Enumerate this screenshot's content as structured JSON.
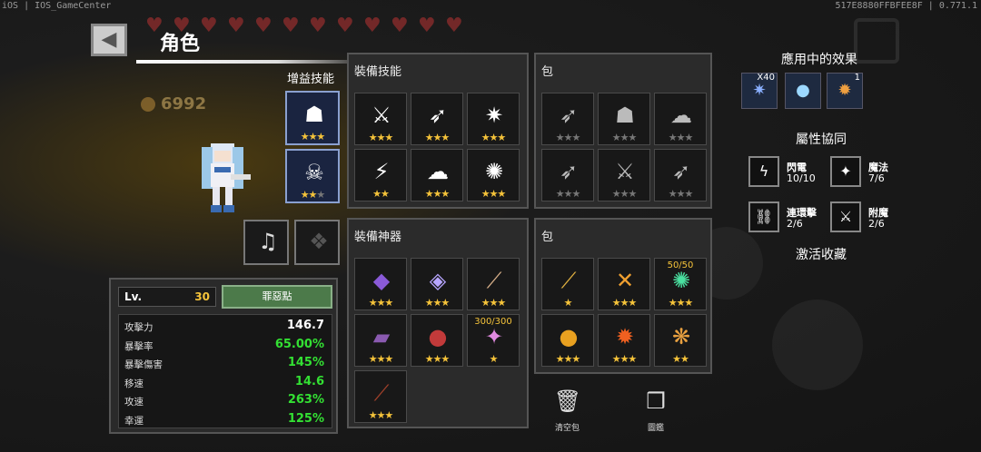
{
  "system": {
    "left": "iOS | IOS_GameCenter",
    "right": "517E8880FFBFEE8F | 0.771.1"
  },
  "header": {
    "title": "角色",
    "coins": "6992"
  },
  "side_label": "增益技能",
  "buff_slots": [
    {
      "icon": "ghost-icon",
      "stars": 3
    },
    {
      "icon": "skull-icon",
      "stars": 2
    }
  ],
  "equip_slots": [
    {
      "icon": "guitar-icon"
    },
    {
      "icon": "rabbit-icon"
    }
  ],
  "skills_panel": {
    "title": "裝備技能",
    "cells": [
      {
        "glyph": "⚔",
        "stars": 3
      },
      {
        "glyph": "➶",
        "stars": 3
      },
      {
        "glyph": "✷",
        "stars": 3
      },
      {
        "glyph": "⚡",
        "stars": 2
      },
      {
        "glyph": "☁",
        "stars": 3
      },
      {
        "glyph": "✺",
        "stars": 3
      }
    ]
  },
  "skills_bag": {
    "title": "包",
    "cells": [
      {
        "glyph": "➶",
        "stars": 3,
        "dim": true
      },
      {
        "glyph": "☗",
        "stars": 3,
        "dim": true
      },
      {
        "glyph": "☁",
        "stars": 3,
        "dim": true
      },
      {
        "glyph": "➶",
        "stars": 3,
        "dim": true
      },
      {
        "glyph": "⚔",
        "stars": 3,
        "dim": true
      },
      {
        "glyph": "➶",
        "stars": 3,
        "dim": true
      }
    ]
  },
  "artifacts_panel": {
    "title": "裝備神器",
    "cells": [
      {
        "glyph": "◆",
        "color": "#8a5ad8",
        "stars": 3
      },
      {
        "glyph": "◈",
        "color": "#b7a5ff",
        "stars": 3
      },
      {
        "glyph": "⟋",
        "color": "#d8b08a",
        "stars": 3
      },
      {
        "glyph": "▰",
        "color": "#8a5ab0",
        "stars": 3
      },
      {
        "glyph": "●",
        "color": "#c23a3a",
        "stars": 3
      },
      {
        "glyph": "✦",
        "color": "#e08ae0",
        "stars": 1,
        "top": "300/300"
      },
      {
        "glyph": "⟋",
        "color": "#a0402a",
        "stars": 3
      }
    ]
  },
  "artifacts_bag": {
    "title": "包",
    "cells": [
      {
        "glyph": "⟋",
        "color": "#e0b040",
        "stars": 1
      },
      {
        "glyph": "✕",
        "color": "#f0a030",
        "stars": 3
      },
      {
        "glyph": "✺",
        "color": "#4ae0a0",
        "stars": 3,
        "top": "50/50"
      },
      {
        "glyph": "●",
        "color": "#e8a020",
        "stars": 3
      },
      {
        "glyph": "✹",
        "color": "#f06020",
        "stars": 3
      },
      {
        "glyph": "❋",
        "color": "#e8a040",
        "stars": 2
      }
    ]
  },
  "stats": {
    "level_label": "Lv.",
    "level": "30",
    "button": "罪惡點",
    "rows": [
      {
        "key": "攻擊力",
        "value": "146.7",
        "color": "#ffffff"
      },
      {
        "key": "暴擊率",
        "value": "65.00%",
        "color": "#33e033"
      },
      {
        "key": "暴擊傷害",
        "value": "145%",
        "color": "#33e033"
      },
      {
        "key": "移速",
        "value": "14.6",
        "color": "#33e033"
      },
      {
        "key": "攻速",
        "value": "263%",
        "color": "#33e033"
      },
      {
        "key": "幸運",
        "value": "125%",
        "color": "#33e033"
      }
    ]
  },
  "effects": {
    "title": "應用中的效果",
    "items": [
      {
        "icon": "star-burst-icon",
        "count": "X40"
      },
      {
        "icon": "apple-icon",
        "count": ""
      },
      {
        "icon": "fire-potion-icon",
        "count": "1"
      }
    ]
  },
  "synergy": {
    "title": "屬性協同",
    "items": [
      {
        "icon": "lightning-icon",
        "name": "閃電",
        "value": "10/10"
      },
      {
        "icon": "magic-icon",
        "name": "魔法",
        "value": "7/6"
      },
      {
        "icon": "chain-icon",
        "name": "連環擊",
        "value": "2/6"
      },
      {
        "icon": "enchant-sword-icon",
        "name": "附魔",
        "value": "2/6"
      }
    ]
  },
  "collection_label": "激活收藏",
  "actions": {
    "clear_bag": "清空包",
    "codex": "圖鑑"
  }
}
